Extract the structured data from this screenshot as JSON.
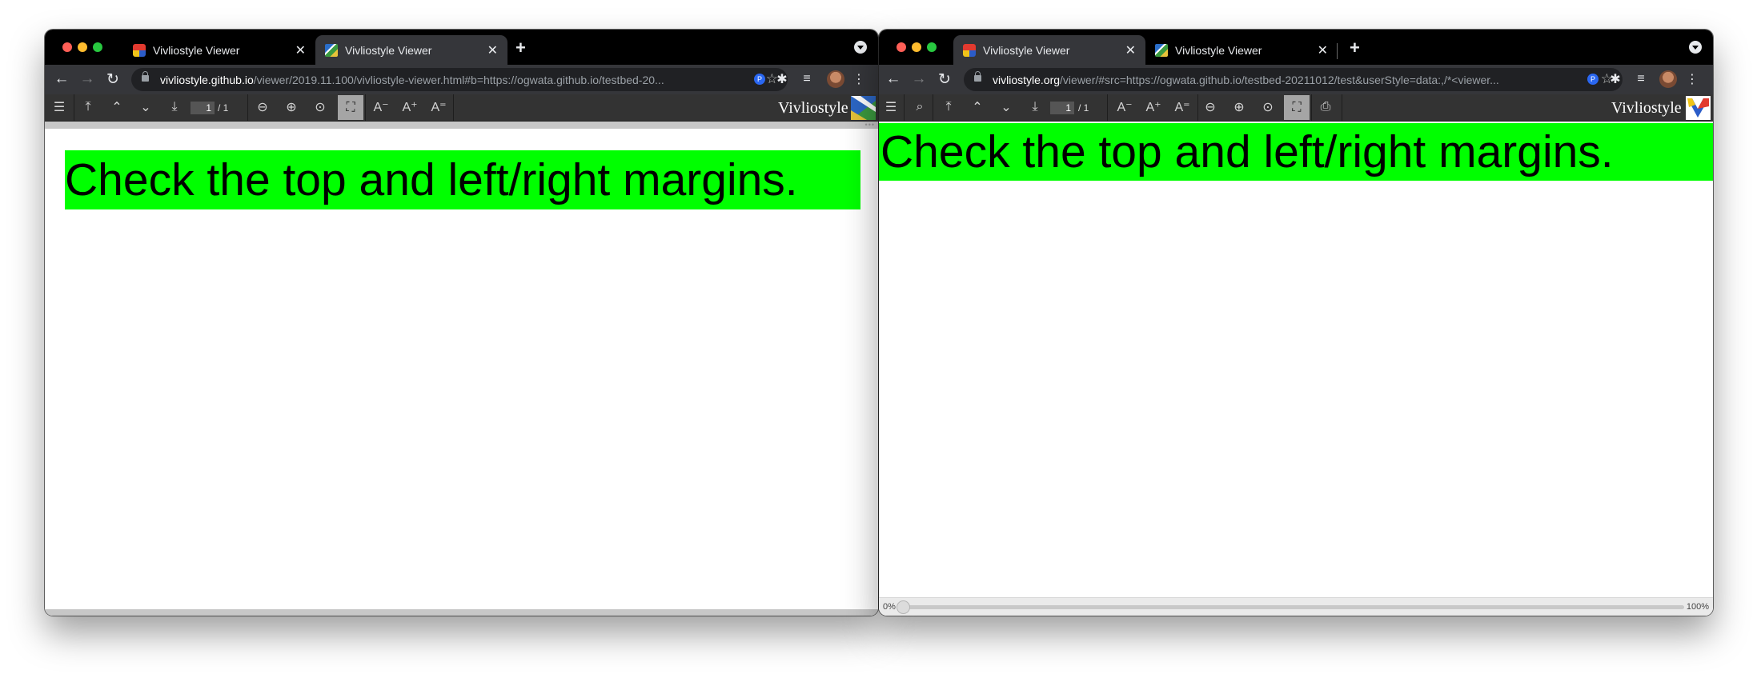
{
  "left_window": {
    "tabs": [
      {
        "title": "Vivliostyle Viewer",
        "close": "✕"
      },
      {
        "title": "Vivliostyle Viewer",
        "close": "✕"
      }
    ],
    "new_tab": "+",
    "url": {
      "host": "vivliostyle.github.io",
      "path": "/viewer/2019.11.100/vivliostyle-viewer.html#b=https://ogwata.github.io/testbed-20..."
    },
    "viewer": {
      "page_current": "1",
      "page_total": "/ 1",
      "brand": "Vivliostyle"
    },
    "document": {
      "heading": "Check the top and left/right margins."
    }
  },
  "right_window": {
    "tabs": [
      {
        "title": "Vivliostyle Viewer",
        "close": "✕"
      },
      {
        "title": "Vivliostyle Viewer",
        "close": "✕"
      }
    ],
    "new_tab": "+",
    "url": {
      "host": "vivliostyle.org",
      "path": "/viewer/#src=https://ogwata.github.io/testbed-20211012/test&userStyle=data:,/*<viewer..."
    },
    "viewer": {
      "page_current": "1",
      "page_total": "/ 1",
      "brand": "Vivliostyle"
    },
    "document": {
      "heading": "Check the top and left/right margins."
    },
    "progress": {
      "start_label": "0%",
      "end_label": "100%",
      "value": 0
    }
  },
  "icons": {
    "back": "arrow-left-icon",
    "forward": "arrow-right-icon",
    "reload": "reload-icon",
    "star": "star-icon",
    "extensions": "puzzle-icon",
    "menu": "kebab-menu-icon"
  },
  "colors": {
    "heading_background": "#00ff00",
    "chrome_dark": "#35363a",
    "viewer_toolbar": "#333333"
  }
}
